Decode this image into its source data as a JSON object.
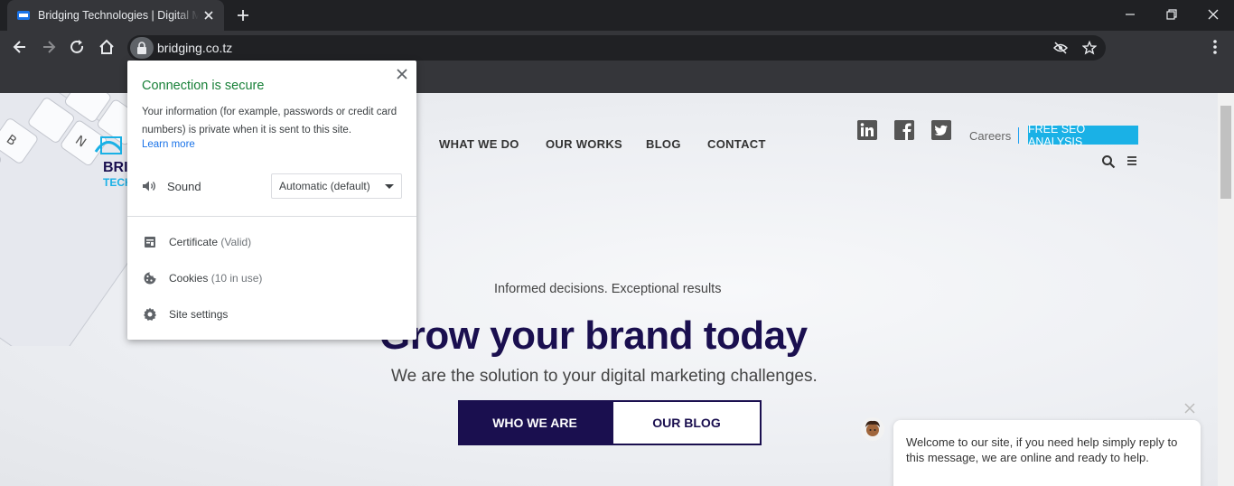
{
  "browser": {
    "tab_title": "Bridging Technologies | Digital M",
    "url": "bridging.co.tz"
  },
  "popup": {
    "title": "Connection is secure",
    "description": "Your information (for example, passwords or credit card numbers) is private when it is sent to this site.",
    "learn_more": "Learn more",
    "sound_label": "Sound",
    "sound_value": "Automatic (default)",
    "certificate_label": "Certificate",
    "certificate_status": "(Valid)",
    "cookies_label": "Cookies",
    "cookies_status": "(10 in use)",
    "site_settings_label": "Site settings"
  },
  "site": {
    "nav": [
      "WHAT WE DO",
      "OUR WORKS",
      "BLOG",
      "CONTACT"
    ],
    "careers": "Careers",
    "seo_button": "FREE SEO ANALYSIS",
    "tagline": "Informed decisions. Exceptional results",
    "headline": "Grow your brand today",
    "subhead": "We are the solution to your digital marketing challenges.",
    "cta_primary": "WHO WE ARE",
    "cta_secondary": "OUR BLOG",
    "logo_text_1": "BRI",
    "logo_text_2": "TECH"
  },
  "chat": {
    "message": "Welcome to our site, if you need help simply reply to this message, we are online and ready to help."
  },
  "colors": {
    "headline": "#1a0f4f",
    "seo_button": "#1ab1e6",
    "secure_green": "#188038",
    "link_blue": "#1a73e8"
  }
}
